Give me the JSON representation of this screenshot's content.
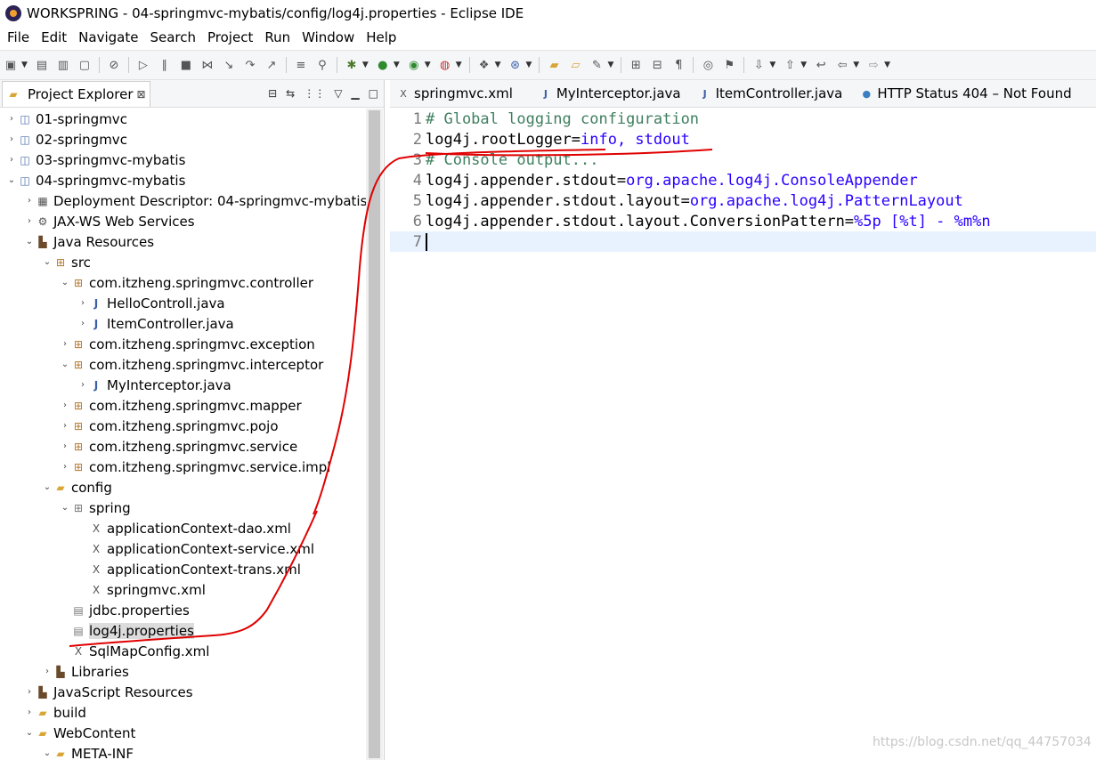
{
  "window": {
    "title": "WORKSPRING - 04-springmvc-mybatis/config/log4j.properties - Eclipse IDE"
  },
  "menu": [
    "File",
    "Edit",
    "Navigate",
    "Search",
    "Project",
    "Run",
    "Window",
    "Help"
  ],
  "explorer": {
    "tab_label": "Project Explorer",
    "close_glyph": "⊠",
    "items": [
      {
        "label": "01-springmvc"
      },
      {
        "label": "02-springmvc"
      },
      {
        "label": "03-springmvc-mybatis"
      },
      {
        "label": "04-springmvc-mybatis"
      },
      {
        "label": "Deployment Descriptor: 04-springmvc-mybatis"
      },
      {
        "label": "JAX-WS Web Services"
      },
      {
        "label": "Java Resources"
      },
      {
        "label": "src"
      },
      {
        "label": "com.itzheng.springmvc.controller"
      },
      {
        "label": "HelloControll.java"
      },
      {
        "label": "ItemController.java"
      },
      {
        "label": "com.itzheng.springmvc.exception"
      },
      {
        "label": "com.itzheng.springmvc.interceptor"
      },
      {
        "label": "MyInterceptor.java"
      },
      {
        "label": "com.itzheng.springmvc.mapper"
      },
      {
        "label": "com.itzheng.springmvc.pojo"
      },
      {
        "label": "com.itzheng.springmvc.service"
      },
      {
        "label": "com.itzheng.springmvc.service.impl"
      },
      {
        "label": "config"
      },
      {
        "label": "spring"
      },
      {
        "label": "applicationContext-dao.xml"
      },
      {
        "label": "applicationContext-service.xml"
      },
      {
        "label": "applicationContext-trans.xml"
      },
      {
        "label": "springmvc.xml"
      },
      {
        "label": "jdbc.properties"
      },
      {
        "label": "log4j.properties"
      },
      {
        "label": "SqlMapConfig.xml"
      },
      {
        "label": "Libraries"
      },
      {
        "label": "JavaScript Resources"
      },
      {
        "label": "build"
      },
      {
        "label": "WebContent"
      },
      {
        "label": "META-INF"
      }
    ]
  },
  "editor": {
    "tabs": [
      {
        "label": "springmvc.xml",
        "icon": "xml-file-icon"
      },
      {
        "label": "MyInterceptor.java",
        "icon": "java-file-icon"
      },
      {
        "label": "ItemController.java",
        "icon": "java-file-icon"
      },
      {
        "label": "HTTP Status 404 – Not Found",
        "icon": "globe-icon"
      }
    ],
    "lines": [
      {
        "num": "1",
        "a": "# Global logging configuration",
        "b": ""
      },
      {
        "num": "2",
        "a": "log4j.rootLogger=",
        "b": "info, stdout"
      },
      {
        "num": "3",
        "a": "# Console output...",
        "b": ""
      },
      {
        "num": "4",
        "a": "log4j.appender.stdout=",
        "b": "org.apache.log4j.ConsoleAppender"
      },
      {
        "num": "5",
        "a": "log4j.appender.stdout.layout=",
        "b": "org.apache.log4j.PatternLayout"
      },
      {
        "num": "6",
        "a": "log4j.appender.stdout.layout.ConversionPattern=",
        "b": "%5p [%t] - %m%n"
      },
      {
        "num": "7",
        "a": "",
        "b": ""
      }
    ]
  },
  "watermark": "https://blog.csdn.net/qq_44757034",
  "colors": {
    "annotation": "#e00000",
    "comment": "#3f7f5f",
    "value": "#2a00ff",
    "current_line": "#e8f2fe"
  }
}
